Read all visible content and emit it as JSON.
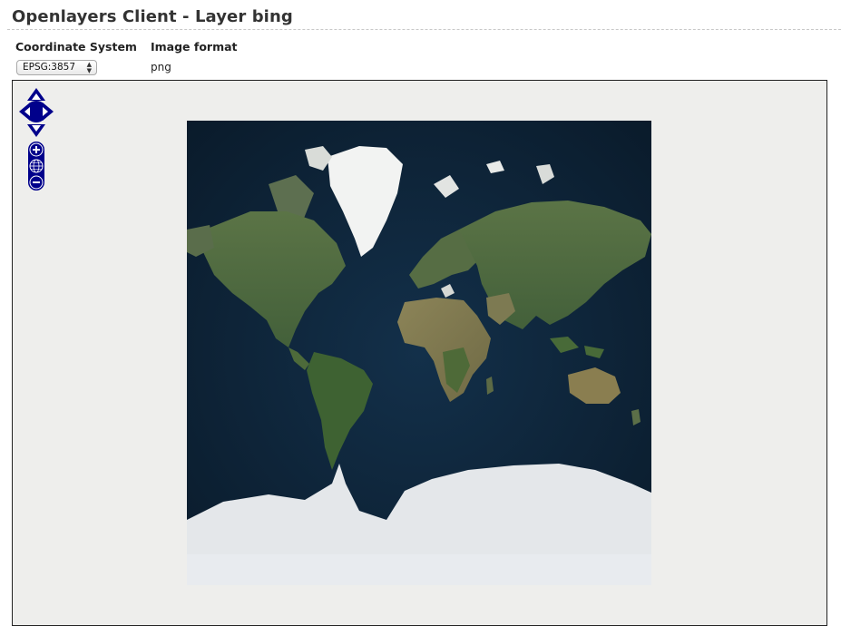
{
  "header": {
    "title": "Openlayers Client - Layer bing"
  },
  "controls": {
    "crs_label": "Coordinate System",
    "crs_selected": "EPSG:3857",
    "format_label": "Image format",
    "format_value": "png"
  },
  "map": {
    "layer": "bing",
    "icons": {
      "pan": "pan-arrows-icon",
      "zoom_in": "zoom-in-icon",
      "zoom_world": "globe-icon",
      "zoom_out": "zoom-out-icon"
    },
    "colors": {
      "control_fill": "#00008b",
      "viewport_bg": "#eeeeec",
      "ocean": "#0d2236",
      "land": "#4f6a3c",
      "ice": "#e6eaee"
    }
  }
}
